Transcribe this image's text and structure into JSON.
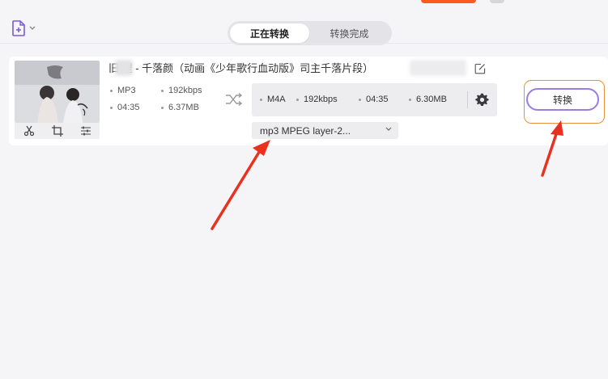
{
  "header": {
    "tabs": [
      {
        "label": "正在转换",
        "active": true
      },
      {
        "label": "转换完成",
        "active": false
      }
    ]
  },
  "file": {
    "title": "旧 哩 - 千落颜（动画《少年歌行血动版》司主千落片段）",
    "source": {
      "format": "MP3",
      "bitrate": "192kbps",
      "duration": "04:35",
      "size": "6.37MB"
    },
    "target": {
      "format": "M4A",
      "bitrate": "192kbps",
      "duration": "04:35",
      "size": "6.30MB"
    },
    "codec": "mp3 MPEG layer-2...",
    "convert_label": "转换"
  },
  "colors": {
    "accent_purple": "#9b7ce0",
    "highlight_orange": "#e8913a",
    "arrow_red": "#e8321f",
    "top_orange": "#ff5a1f"
  },
  "icons": {
    "add_file": "add-file-icon",
    "trim": "scissors-icon",
    "crop": "crop-icon",
    "effects": "sliders-icon",
    "edit": "edit-icon",
    "shuffle": "shuffle-icon",
    "settings": "gear-icon",
    "dropdown": "chevron-down-icon"
  }
}
